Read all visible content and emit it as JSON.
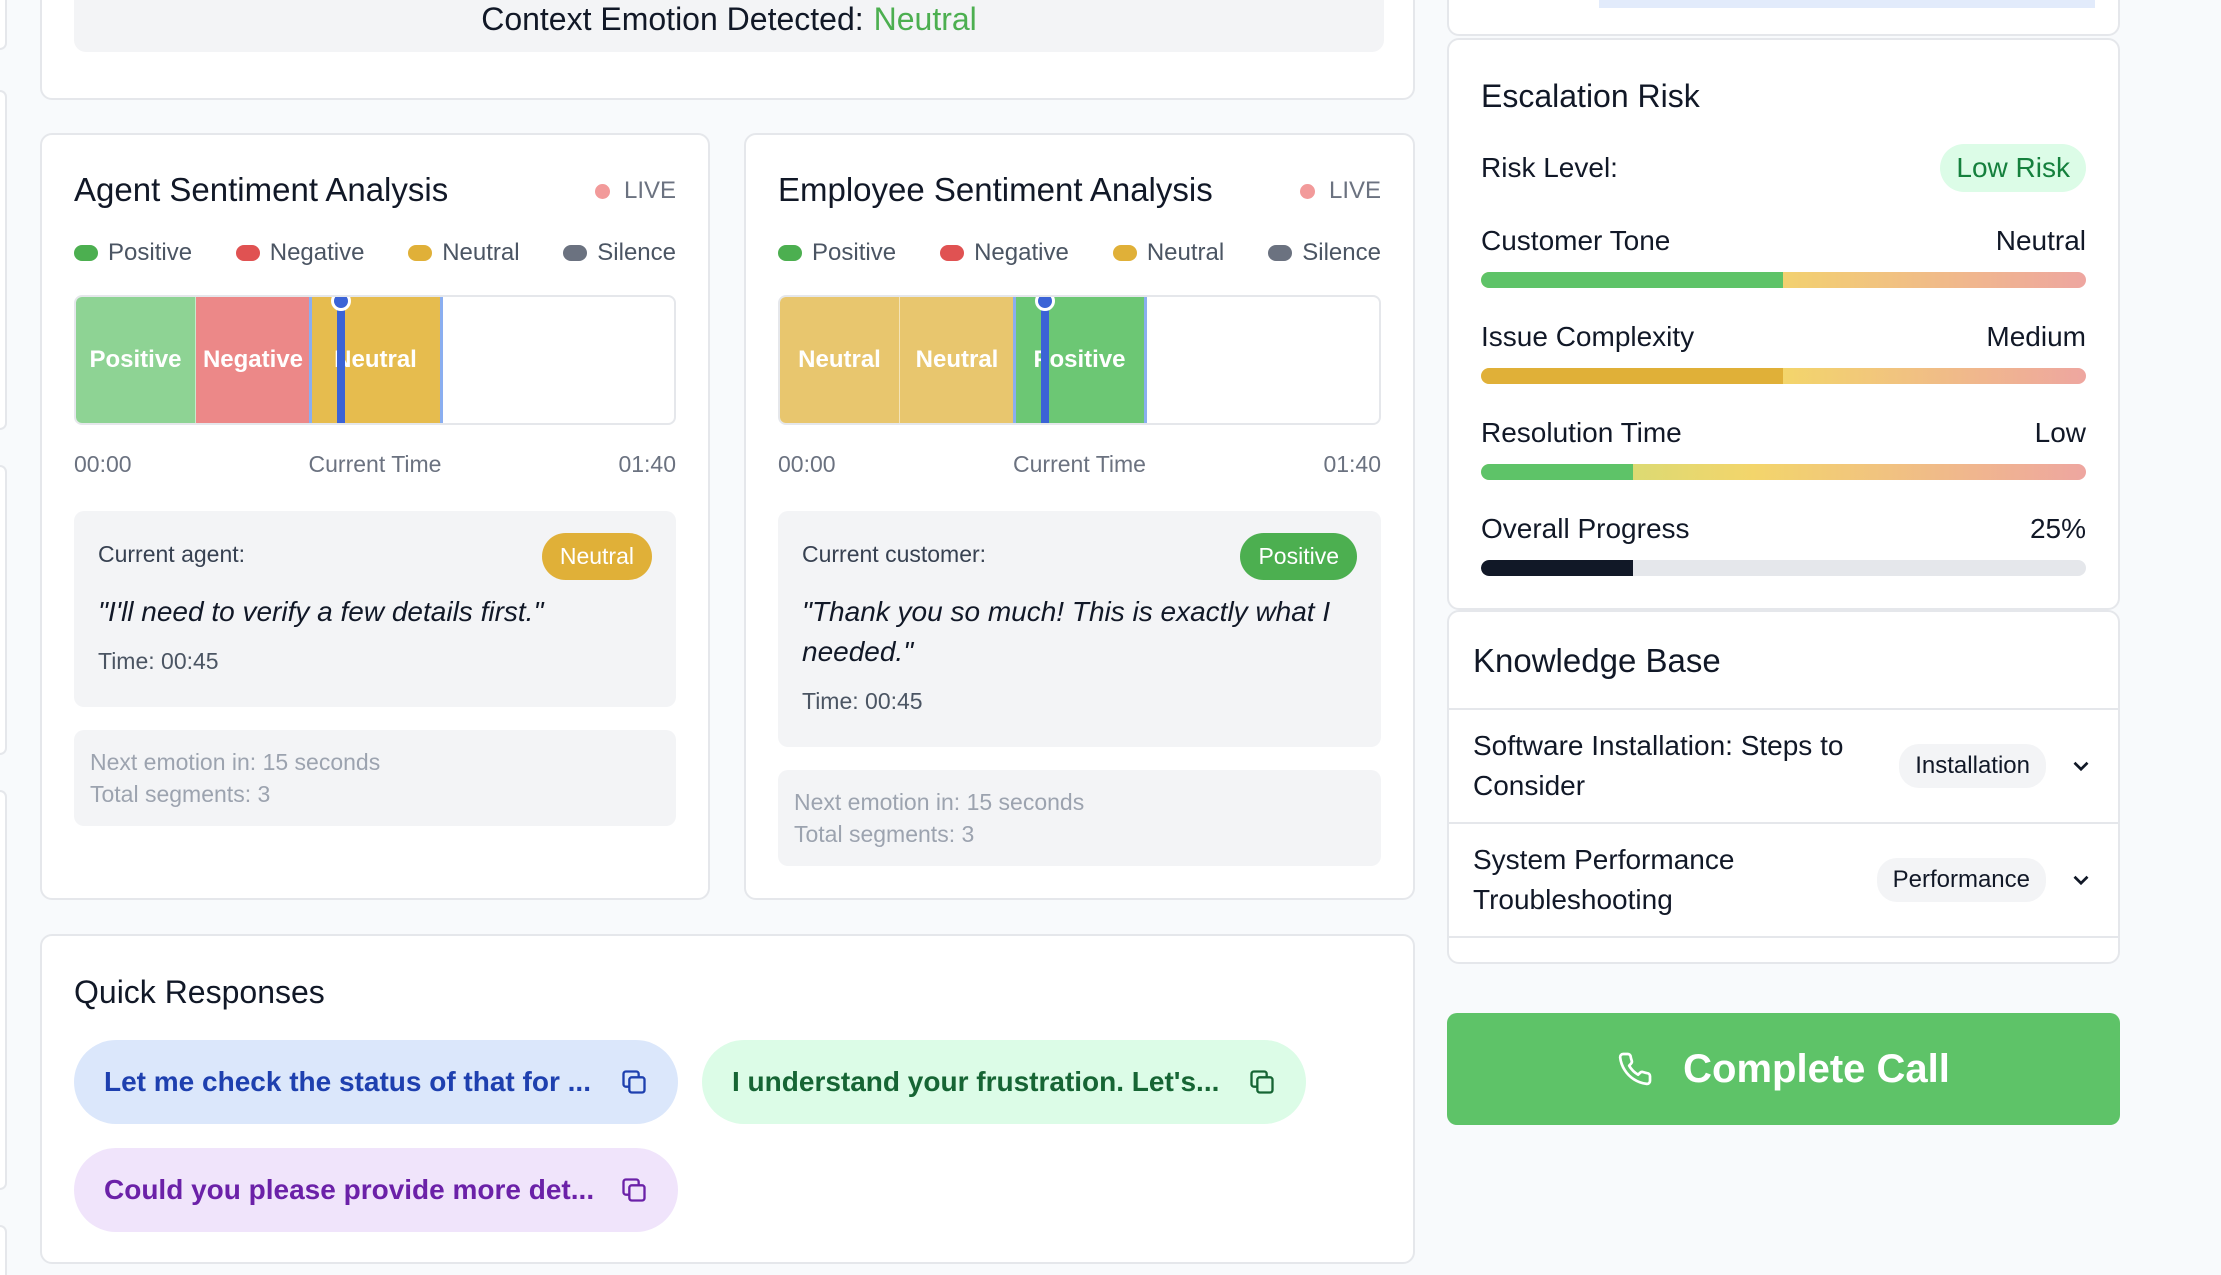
{
  "context": {
    "label": "Context Emotion Detected:",
    "value": "Neutral"
  },
  "legend": {
    "positive": "Positive",
    "negative": "Negative",
    "neutral": "Neutral",
    "silence": "Silence"
  },
  "colors": {
    "positive": "#4caf50",
    "negative": "#e05252",
    "neutral": "#e0b038",
    "silence": "#6b7280",
    "seg_positive": "#8ed394",
    "seg_negative": "#ec8888",
    "seg_neutral": "#e8c66e",
    "seg_neutral_strong": "#e6bc4e",
    "seg_positive_strong": "#6cc774",
    "accent_blue": "#3b63d6",
    "complete_green": "#5ec368"
  },
  "agent": {
    "title": "Agent Sentiment Analysis",
    "live": "LIVE",
    "segments": [
      {
        "label": "Positive",
        "sentiment": "positive"
      },
      {
        "label": "Negative",
        "sentiment": "negative"
      },
      {
        "label": "Neutral",
        "sentiment": "neutral"
      }
    ],
    "time_start": "00:00",
    "time_mid": "Current Time",
    "time_end": "01:40",
    "current_label": "Current agent:",
    "current_badge": "Neutral",
    "quote": "\"I'll need to verify a few details first.\"",
    "time": "Time: 00:45",
    "next_emotion": "Next emotion in: 15 seconds",
    "total_segments": "Total segments: 3"
  },
  "employee": {
    "title": "Employee Sentiment Analysis",
    "live": "LIVE",
    "segments": [
      {
        "label": "Neutral",
        "sentiment": "neutral"
      },
      {
        "label": "Neutral",
        "sentiment": "neutral"
      },
      {
        "label": "Positive",
        "sentiment": "positive"
      }
    ],
    "time_start": "00:00",
    "time_mid": "Current Time",
    "time_end": "01:40",
    "current_label": "Current customer:",
    "current_badge": "Positive",
    "quote": "\"Thank you so much! This is exactly what I needed.\"",
    "time": "Time: 00:45",
    "next_emotion": "Next emotion in: 15 seconds",
    "total_segments": "Total segments: 3"
  },
  "quick_responses": {
    "title": "Quick Responses",
    "items": [
      "Let me check the status of that for ...",
      "I understand your frustration. Let's...",
      "Could you please provide more det..."
    ]
  },
  "escalation": {
    "title": "Escalation Risk",
    "risk_label": "Risk Level:",
    "risk_value": "Low Risk",
    "metrics": [
      {
        "label": "Customer Tone",
        "value": "Neutral",
        "fill": 0.5
      },
      {
        "label": "Issue Complexity",
        "value": "Medium",
        "fill": 0.5
      },
      {
        "label": "Resolution Time",
        "value": "Low",
        "fill": 0.25
      },
      {
        "label": "Overall Progress",
        "value": "25%",
        "fill": 0.25
      }
    ]
  },
  "knowledge_base": {
    "title": "Knowledge Base",
    "items": [
      {
        "title": "Software Installation: Steps to Consider",
        "tag": "Installation"
      },
      {
        "title": "System Performance Troubleshooting",
        "tag": "Performance"
      }
    ]
  },
  "complete_call": {
    "label": "Complete Call",
    "icon": "phone-icon"
  }
}
